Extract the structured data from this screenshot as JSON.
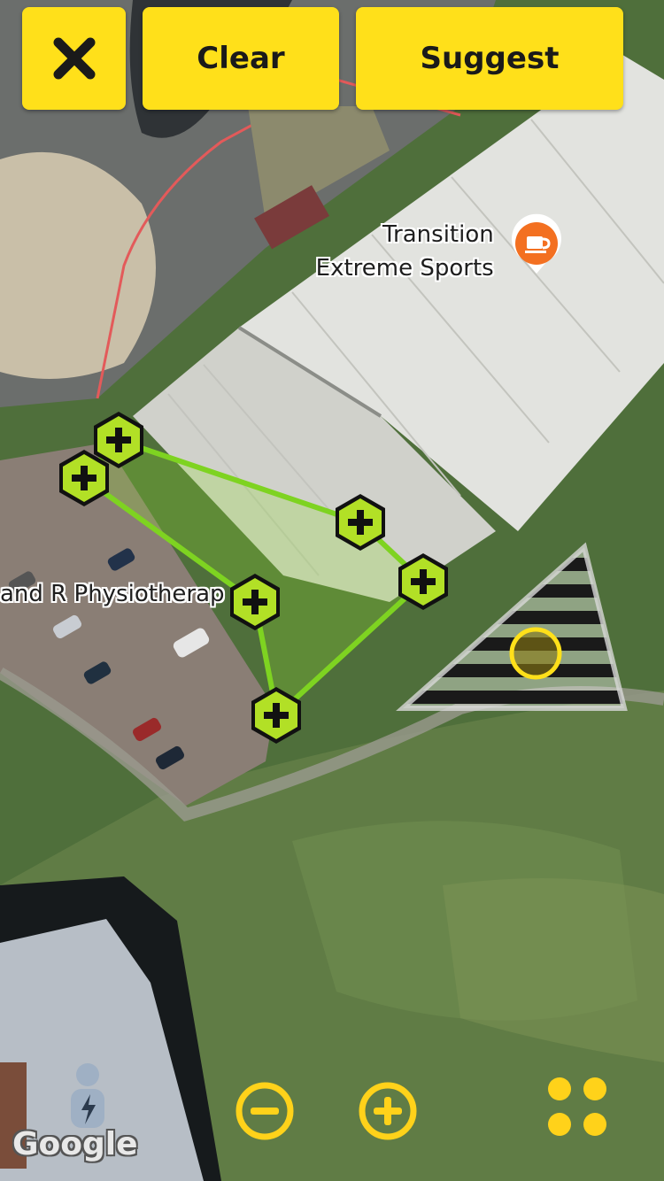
{
  "toolbar": {
    "close_icon": "close-x-icon",
    "clear_label": "Clear",
    "suggest_label": "Suggest",
    "button_color": "#ffe01a"
  },
  "map": {
    "type": "satellite",
    "poi": {
      "line1": "Transition",
      "line2": "Extreme Sports",
      "icon": "cafe-cup-icon",
      "icon_color": "#f37021"
    },
    "place_label": "and R Physiotherap",
    "attribution": "Google",
    "polygon_color": "#7ed321",
    "vertex_marker_icon": "hexagon-plus-icon",
    "vertex_count": 6
  },
  "controls": {
    "street_view_icon": "pegman-lightning-icon",
    "zoom_out_icon": "minus-circle-icon",
    "zoom_in_icon": "plus-circle-icon",
    "layers_icon": "four-dots-icon",
    "accent": "#ffd21a"
  }
}
